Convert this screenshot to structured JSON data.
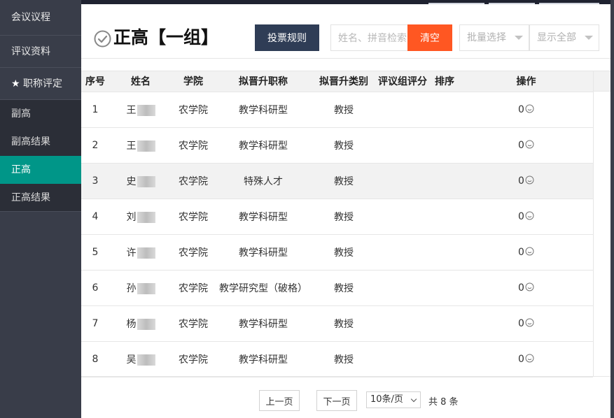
{
  "sidebar": {
    "items": [
      {
        "label": "会议议程"
      },
      {
        "label": "评议资料"
      },
      {
        "label": "职称评定"
      }
    ],
    "sub_items": [
      {
        "label": "副高"
      },
      {
        "label": "副高结果"
      },
      {
        "label": "正高"
      },
      {
        "label": "正高结果"
      }
    ],
    "active": "正高"
  },
  "header": {
    "title": "正高【一组】",
    "rules_button": "投票规则",
    "search_placeholder": "姓名、拼音检索",
    "clear_button": "清空",
    "batch_select": "批量选择",
    "show_select": "显示全部"
  },
  "table": {
    "columns": [
      "序号",
      "姓名",
      "学院",
      "拟晋升职称",
      "拟晋升类别",
      "评议组评分",
      "排序",
      "操作"
    ],
    "rows": [
      {
        "no": "1",
        "name": "王",
        "college": "农学院",
        "title": "教学科研型",
        "category": "教授",
        "score": "",
        "rank": "",
        "op": "0"
      },
      {
        "no": "2",
        "name": "王",
        "college": "农学院",
        "title": "教学科研型",
        "category": "教授",
        "score": "",
        "rank": "",
        "op": "0"
      },
      {
        "no": "3",
        "name": "史",
        "college": "农学院",
        "title": "特殊人才",
        "category": "教授",
        "score": "",
        "rank": "",
        "op": "0"
      },
      {
        "no": "4",
        "name": "刘",
        "college": "农学院",
        "title": "教学科研型",
        "category": "教授",
        "score": "",
        "rank": "",
        "op": "0"
      },
      {
        "no": "5",
        "name": "许",
        "college": "农学院",
        "title": "教学科研型",
        "category": "教授",
        "score": "",
        "rank": "",
        "op": "0"
      },
      {
        "no": "6",
        "name": "孙",
        "college": "农学院",
        "title": "教学研究型（破格）",
        "category": "教授",
        "score": "",
        "rank": "",
        "op": "0"
      },
      {
        "no": "7",
        "name": "杨",
        "college": "农学院",
        "title": "教学科研型",
        "category": "教授",
        "score": "",
        "rank": "",
        "op": "0"
      },
      {
        "no": "8",
        "name": "吴",
        "college": "农学院",
        "title": "教学科研型",
        "category": "教授",
        "score": "",
        "rank": "",
        "op": "0"
      }
    ],
    "highlighted_row": 3
  },
  "pager": {
    "prev": "上一页",
    "next": "下一页",
    "page_size": "10条/页",
    "total": "共 8 条"
  },
  "colors": {
    "sidebar_bg": "#393d49",
    "active_item": "#009688",
    "rules_button": "#2f3d56",
    "clear_button": "#ff5722"
  }
}
